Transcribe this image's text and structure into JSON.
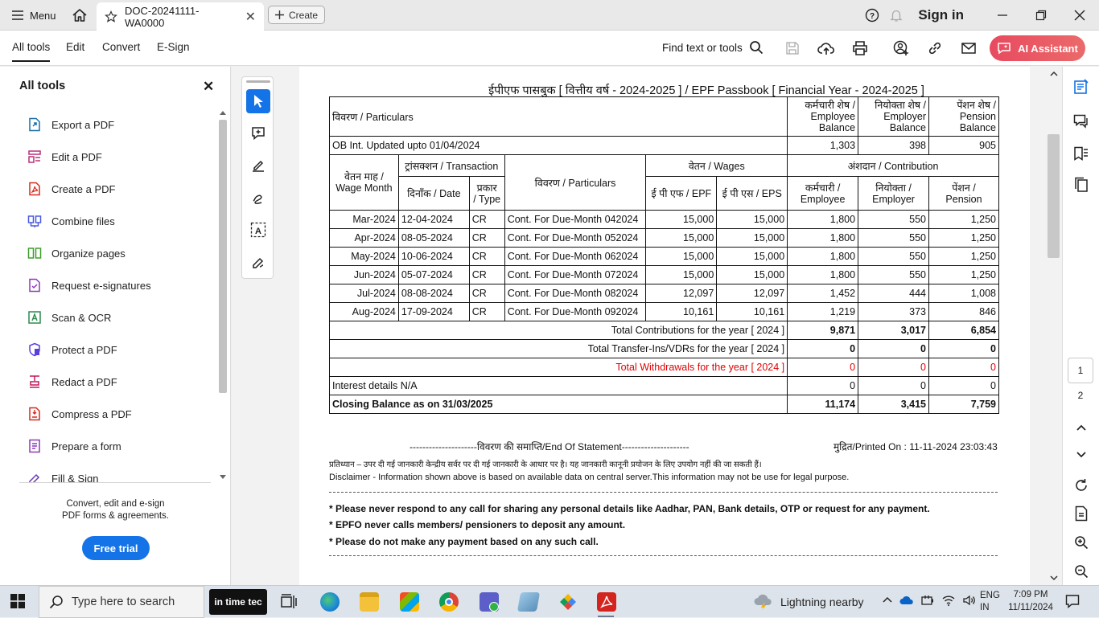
{
  "titlebar": {
    "menu_label": "Menu",
    "tab_title": "DOC-20241111-WA0000",
    "tab_close": "✕",
    "create_label": "Create",
    "sign_in": "Sign in"
  },
  "menubar": {
    "tabs": [
      "All tools",
      "Edit",
      "Convert",
      "E-Sign"
    ],
    "find_label": "Find text or tools",
    "ai_assistant": "AI Assistant"
  },
  "left_panel": {
    "title": "All tools",
    "close": "✕",
    "items": [
      {
        "label": "Export a PDF",
        "icon": "export-pdf-icon",
        "color": "#1b6ea8"
      },
      {
        "label": "Edit a PDF",
        "icon": "edit-pdf-icon",
        "color": "#b8317a"
      },
      {
        "label": "Create a PDF",
        "icon": "create-pdf-icon",
        "color": "#d52b1e"
      },
      {
        "label": "Combine files",
        "icon": "combine-files-icon",
        "color": "#4a5ae0"
      },
      {
        "label": "Organize pages",
        "icon": "organize-pages-icon",
        "color": "#3f9e2b"
      },
      {
        "label": "Request e-signatures",
        "icon": "request-esign-icon",
        "color": "#8a3ab9"
      },
      {
        "label": "Scan & OCR",
        "icon": "scan-ocr-icon",
        "color": "#2d8a4e"
      },
      {
        "label": "Protect a PDF",
        "icon": "protect-pdf-icon",
        "color": "#5a3ee0"
      },
      {
        "label": "Redact a PDF",
        "icon": "redact-pdf-icon",
        "color": "#c2185b"
      },
      {
        "label": "Compress a PDF",
        "icon": "compress-pdf-icon",
        "color": "#d52b1e"
      },
      {
        "label": "Prepare a form",
        "icon": "prepare-form-icon",
        "color": "#8a3ab9"
      },
      {
        "label": "Fill & Sign",
        "icon": "fill-sign-icon",
        "color": "#6a3ab9"
      }
    ],
    "promo_line1": "Convert, edit and e-sign",
    "promo_line2": "PDF forms & agreements.",
    "trial_button": "Free trial"
  },
  "document": {
    "title": "ईपीएफ पासबुक  [ वित्तीय वर्ष - 2024-2025 ] / EPF Passbook [ Financial Year - 2024-2025 ]",
    "header": {
      "particulars": "विवरण / Particulars",
      "employee_balance": [
        "कर्मचारी शेष /",
        "Employee",
        "Balance"
      ],
      "employer_balance": [
        "नियोक्ता शेष /",
        "Employer",
        "Balance"
      ],
      "pension_balance": [
        "पेंशन शेष /",
        "Pension",
        "Balance"
      ]
    },
    "ob_row": {
      "label": "OB Int. Updated upto 01/04/2024",
      "employee": "1,303",
      "employer": "398",
      "pension": "905"
    },
    "sub_header": {
      "wage_month": [
        "वेतन माह  /",
        "Wage Month"
      ],
      "transaction": "ट्रांसक्शन   / Transaction",
      "date": "दिनाँक    / Date",
      "type": [
        "प्रकार",
        "/ Type"
      ],
      "particulars": "विवरण / Particulars",
      "wages": "वेतन   / Wages",
      "epf": "ई पी एफ  / EPF",
      "eps": "ई पी एस   / EPS",
      "contribution": "अंशदान   / Contribution",
      "employee": [
        "कर्मचारी  /",
        "Employee"
      ],
      "employer": [
        "नियोक्ता  /",
        "Employer"
      ],
      "pension": [
        "पेंशन  /",
        "Pension"
      ]
    },
    "rows": [
      {
        "month": "Mar-2024",
        "date": "12-04-2024",
        "type": "CR",
        "particulars": "Cont. For Due-Month 042024",
        "epf": "15,000",
        "eps": "15,000",
        "employee": "1,800",
        "employer": "550",
        "pension": "1,250"
      },
      {
        "month": "Apr-2024",
        "date": "08-05-2024",
        "type": "CR",
        "particulars": "Cont. For Due-Month 052024",
        "epf": "15,000",
        "eps": "15,000",
        "employee": "1,800",
        "employer": "550",
        "pension": "1,250"
      },
      {
        "month": "May-2024",
        "date": "10-06-2024",
        "type": "CR",
        "particulars": "Cont. For Due-Month 062024",
        "epf": "15,000",
        "eps": "15,000",
        "employee": "1,800",
        "employer": "550",
        "pension": "1,250"
      },
      {
        "month": "Jun-2024",
        "date": "05-07-2024",
        "type": "CR",
        "particulars": "Cont. For Due-Month 072024",
        "epf": "15,000",
        "eps": "15,000",
        "employee": "1,800",
        "employer": "550",
        "pension": "1,250"
      },
      {
        "month": "Jul-2024",
        "date": "08-08-2024",
        "type": "CR",
        "particulars": "Cont. For Due-Month 082024",
        "epf": "12,097",
        "eps": "12,097",
        "employee": "1,452",
        "employer": "444",
        "pension": "1,008"
      },
      {
        "month": "Aug-2024",
        "date": "17-09-2024",
        "type": "CR",
        "particulars": "Cont. For Due-Month 092024",
        "epf": "10,161",
        "eps": "10,161",
        "employee": "1,219",
        "employer": "373",
        "pension": "846"
      }
    ],
    "totals": {
      "contributions": {
        "label": "Total Contributions for the year [ 2024 ]",
        "employee": "9,871",
        "employer": "3,017",
        "pension": "6,854"
      },
      "transfers": {
        "label": "Total Transfer-Ins/VDRs for the year [ 2024 ]",
        "employee": "0",
        "employer": "0",
        "pension": "0"
      },
      "withdrawals": {
        "label": "Total Withdrawals  for the year [ 2024 ]",
        "employee": "0",
        "employer": "0",
        "pension": "0"
      },
      "interest": {
        "label": "Interest details N/A",
        "employee": "0",
        "employer": "0",
        "pension": "0"
      },
      "closing": {
        "label": "Closing Balance as on 31/03/2025",
        "employee": "11,174",
        "employer": "3,415",
        "pension": "7,759"
      }
    },
    "end_statement": "---------------------विवरण की समाप्ति/End Of Statement---------------------",
    "printed_on": "मुद्रित/Printed On : 11-11-2024 23:03:43",
    "hindi_disclaimer": "प्रतिध्यान – उपर दी गई जानकारी केन्द्रीय सर्वर पर दी गई जानकारी के आधार पर है। यह जानकारी कानूनी प्रयोजन के लिए उपयोग नहीं की जा सकती हैं।",
    "disclaimer": "Disclaimer - Information shown above is based on available data on central server.This information may not be use for legal purpose.",
    "warnings": [
      "* Please never respond to any call for sharing any personal details like Aadhar, PAN, Bank details, OTP or request for any payment.",
      "* EPFO never calls members/ pensioners to deposit any amount.",
      "* Please do not make any payment based on any such call."
    ]
  },
  "right_rail": {
    "current_page": "1",
    "next_page": "2"
  },
  "taskbar": {
    "search_placeholder": "Type here to search",
    "intime_label": "in time tec",
    "weather": "Lightning nearby",
    "lang_line1": "ENG",
    "lang_line2": "IN",
    "time": "7:09 PM",
    "date": "11/11/2024"
  },
  "colors": {
    "accent": "#1473e6",
    "ai_gradient_start": "#e84a5f",
    "withdrawal_red": "#e00000"
  }
}
